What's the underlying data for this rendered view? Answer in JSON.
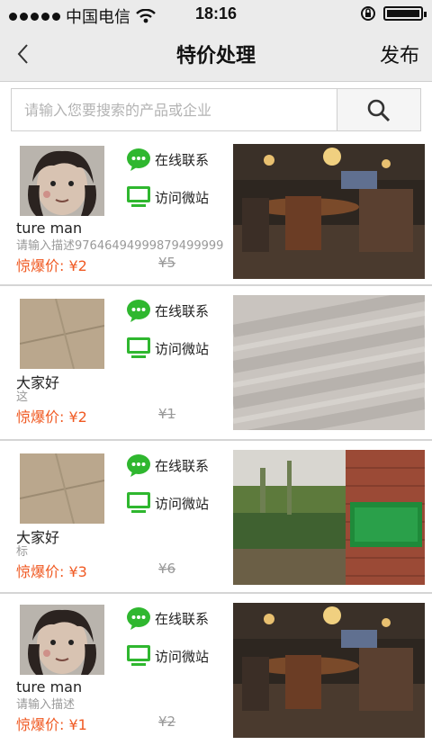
{
  "status_bar": {
    "carrier": "中国电信",
    "time": "18:16",
    "battery_icon": "battery-icon"
  },
  "nav": {
    "title": "特价处理",
    "publish": "发布",
    "back_icon": "back-chevron-icon"
  },
  "search": {
    "placeholder": "请输入您要搜索的产品或企业",
    "icon": "search-icon"
  },
  "list": {
    "items": [
      {
        "name": "ture man",
        "desc": "请输入描述97646494999879499999",
        "price": "惊爆价: ¥2",
        "old_price": "¥5",
        "chat_label": "在线联系",
        "site_label": "访问微站"
      },
      {
        "name": "大家好",
        "desc": "这",
        "price": "惊爆价: ¥2",
        "old_price": "¥1",
        "chat_label": "在线联系",
        "site_label": "访问微站"
      },
      {
        "name": "大家好",
        "desc": "标",
        "price": "惊爆价: ¥3",
        "old_price": "¥6",
        "chat_label": "在线联系",
        "site_label": "访问微站"
      },
      {
        "name": "ture man",
        "desc": "请输入描述",
        "price": "惊爆价: ¥1",
        "old_price": "¥2",
        "chat_label": "在线联系",
        "site_label": "访问微站"
      }
    ]
  },
  "colors": {
    "accent_green": "#2fb72f",
    "price_orange": "#f05a23",
    "nav_bg": "#ebebeb"
  }
}
